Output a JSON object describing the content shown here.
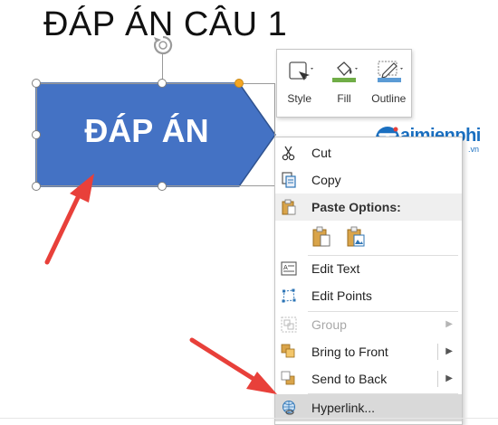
{
  "slide": {
    "title": "ĐÁP ÁN CÂU 1",
    "shape_text": "ĐÁP ÁN",
    "shape_color": "#4472c4"
  },
  "mini_toolbar": {
    "style_label": "Style",
    "fill_label": "Fill",
    "outline_label": "Outline",
    "fill_color": "#70ad47",
    "outline_color": "#5b9bd5"
  },
  "logo": {
    "text": "aimienphi",
    "suffix": ".vn",
    "icon": "taimienphi-logo-icon",
    "color": "#1a6fc0"
  },
  "context_menu": {
    "cut": "Cut",
    "copy": "Copy",
    "paste_options": "Paste Options:",
    "edit_text": "Edit Text",
    "edit_points": "Edit Points",
    "group": "Group",
    "bring_to_front": "Bring to Front",
    "send_to_back": "Send to Back",
    "hyperlink": "Hyperlink..."
  },
  "annotation_color": "#e8403a"
}
